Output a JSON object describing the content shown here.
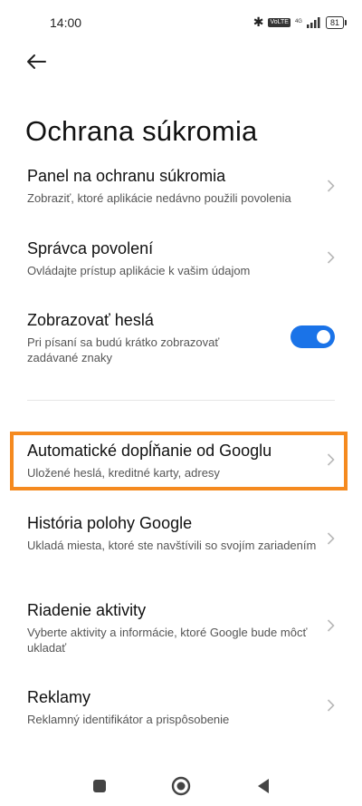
{
  "status_bar": {
    "time": "14:00",
    "icons": [
      "bluetooth-icon",
      "volte-icon",
      "signal-4g-icon",
      "signal-bars-icon",
      "battery-icon"
    ],
    "net_label": "VoLTE",
    "tech_label": "4G",
    "battery": "81"
  },
  "header": {
    "back_icon": "arrow-left-icon",
    "title": "Ochrana súkromia"
  },
  "items": [
    {
      "title": "Panel na ochranu súkromia",
      "subtitle": "Zobraziť, ktoré aplikácie nedávno použili povolenia",
      "control": "chevron"
    },
    {
      "title": "Správca povolení",
      "subtitle": "Ovládajte prístup aplikácie k vašim údajom",
      "control": "chevron"
    },
    {
      "title": "Zobrazovať heslá",
      "subtitle": "Pri písaní sa budú krátko zobrazovať zadávané znaky",
      "control": "toggle",
      "toggle_on": true
    },
    {
      "title": "Automatické dopĺňanie od Googlu",
      "subtitle": "Uložené heslá, kreditné karty, adresy",
      "control": "chevron",
      "highlighted": true
    },
    {
      "title": "História polohy Google",
      "subtitle": "Ukladá miesta, ktoré ste navštívili so svojím zariadením",
      "control": "chevron"
    },
    {
      "title": "Riadenie aktivity",
      "subtitle": "Vyberte aktivity a informácie, ktoré Google bude môcť ukladať",
      "control": "chevron"
    },
    {
      "title": "Reklamy",
      "subtitle": "Reklamný identifikátor a prispôsobenie",
      "control": "chevron"
    }
  ],
  "colors": {
    "accent": "#1a73e8",
    "highlight": "#f58a1f",
    "text_primary": "#111111",
    "text_secondary": "#555555"
  },
  "nav_bar": {
    "icons": [
      "recents-square-icon",
      "home-circle-icon",
      "back-triangle-icon"
    ]
  }
}
